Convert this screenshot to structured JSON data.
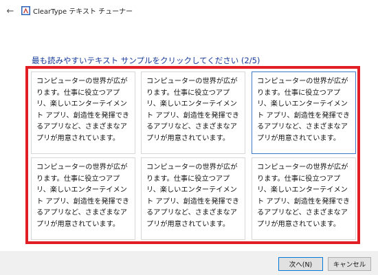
{
  "window": {
    "back_glyph": "←",
    "title": "ClearType テキスト チューナー"
  },
  "instruction": "最も読みやすいテキスト サンプルをクリックしてください (2/5)",
  "samples": [
    {
      "text": "コンピューターの世界が広がります。仕事に役立つアプリ、楽しいエンターテイメント アプリ、創造性を発揮できるアプリなど、さまざまなアプリが用意されています。"
    },
    {
      "text": "コンピューターの世界が広がります。仕事に役立つアプリ、楽しいエンターテイメント アプリ、創造性を発揮できるアプリなど、さまざまなアプリが用意されています。"
    },
    {
      "text": "コンピューターの世界が広がります。仕事に役立つアプリ、楽しいエンターテイメント アプリ、創造性を発揮できるアプリなど、さまざまなアプリが用意されています。",
      "selected": true
    },
    {
      "text": "コンピューターの世界が広がります。仕事に役立つアプリ、楽しいエンターテイメント アプリ、創造性を発揮できるアプリなど、さまざまなアプリが用意されています。"
    },
    {
      "text": "コンピューターの世界が広がります。仕事に役立つアプリ、楽しいエンターテイメント アプリ、創造性を発揮できるアプリなど、さまざまなアプリが用意されています。"
    },
    {
      "text": "コンピューターの世界が広がります。仕事に役立つアプリ、楽しいエンターテイメント アプリ、創造性を発揮できるアプリなど、さまざまなアプリが用意されています。"
    }
  ],
  "buttons": {
    "next": "次へ(N)",
    "cancel": "キャンセル"
  },
  "colors": {
    "highlight_frame": "#e01e24",
    "selected_border": "#3c78c8",
    "instruction_text": "#1a3d9a"
  },
  "icons": {
    "back": "back-arrow-icon",
    "app": "cleartype-app-icon"
  }
}
